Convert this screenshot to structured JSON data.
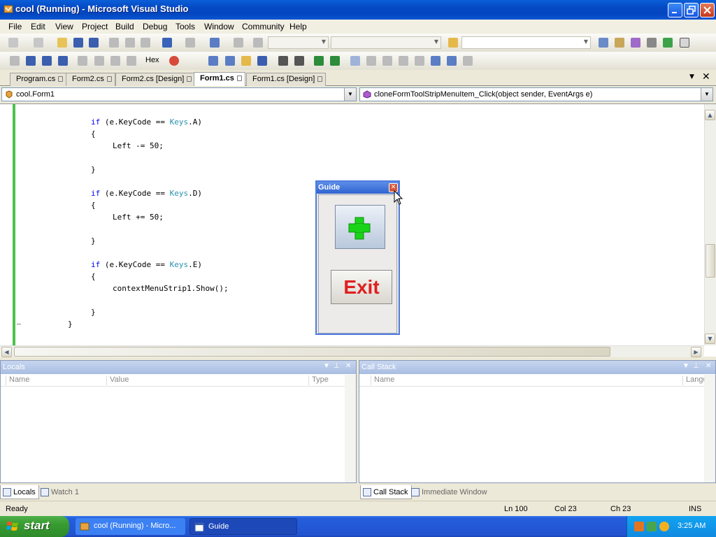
{
  "window": {
    "title": "cool (Running) - Microsoft Visual Studio"
  },
  "menu": [
    "File",
    "Edit",
    "View",
    "Project",
    "Build",
    "Debug",
    "Tools",
    "Window",
    "Community",
    "Help"
  ],
  "toolbar": {
    "hex_label": "Hex"
  },
  "tabs": [
    {
      "label": "Program.cs",
      "active": false
    },
    {
      "label": "Form2.cs",
      "active": false
    },
    {
      "label": "Form2.cs [Design]",
      "active": false
    },
    {
      "label": "Form1.cs",
      "active": true
    },
    {
      "label": "Form1.cs [Design]",
      "active": false
    }
  ],
  "nav": {
    "class_combo": "cool.Form1",
    "member_combo": "cloneFormToolStripMenuItem_Click(object sender, EventArgs e)"
  },
  "code": {
    "l1_if": "if",
    "l1_rest": " (e.KeyCode == ",
    "l1_type": "Keys",
    "l1_end": ".A)",
    "l2": "{",
    "l3": "Left -= 50;",
    "l4": "}",
    "l5_if": "if",
    "l5_rest": " (e.KeyCode == ",
    "l5_type": "Keys",
    "l5_end": ".D)",
    "l6": "{",
    "l7": "Left += 50;",
    "l8": "}",
    "l9_if": "if",
    "l9_rest": " (e.KeyCode == ",
    "l9_type": "Keys",
    "l9_end": ".E)",
    "l10": "{",
    "l11": "contextMenuStrip1.Show();",
    "l12": "}",
    "l13": "}"
  },
  "guide": {
    "title": "Guide",
    "exit_label": "Exit"
  },
  "locals": {
    "title": "Locals",
    "columns": [
      "Name",
      "Value",
      "Type"
    ],
    "tabs": [
      "Locals",
      "Watch 1"
    ]
  },
  "callstack": {
    "title": "Call Stack",
    "columns": [
      "Name",
      "Langu"
    ],
    "tabs": [
      "Call Stack",
      "Immediate Window"
    ]
  },
  "status": {
    "text": "Ready",
    "ln": "Ln 100",
    "col": "Col 23",
    "ch": "Ch 23",
    "mode": "INS"
  },
  "taskbar": {
    "start_label": "start",
    "tasks": [
      {
        "label": "cool (Running) - Micro...",
        "active": false
      },
      {
        "label": "Guide",
        "active": true
      }
    ],
    "clock": "3:25 AM"
  },
  "colors": {
    "keyword": "#0000ff",
    "type": "#2b91af",
    "exit_text": "#e01f1f",
    "plus": "#19d319",
    "titlebar": "#0449c4"
  }
}
